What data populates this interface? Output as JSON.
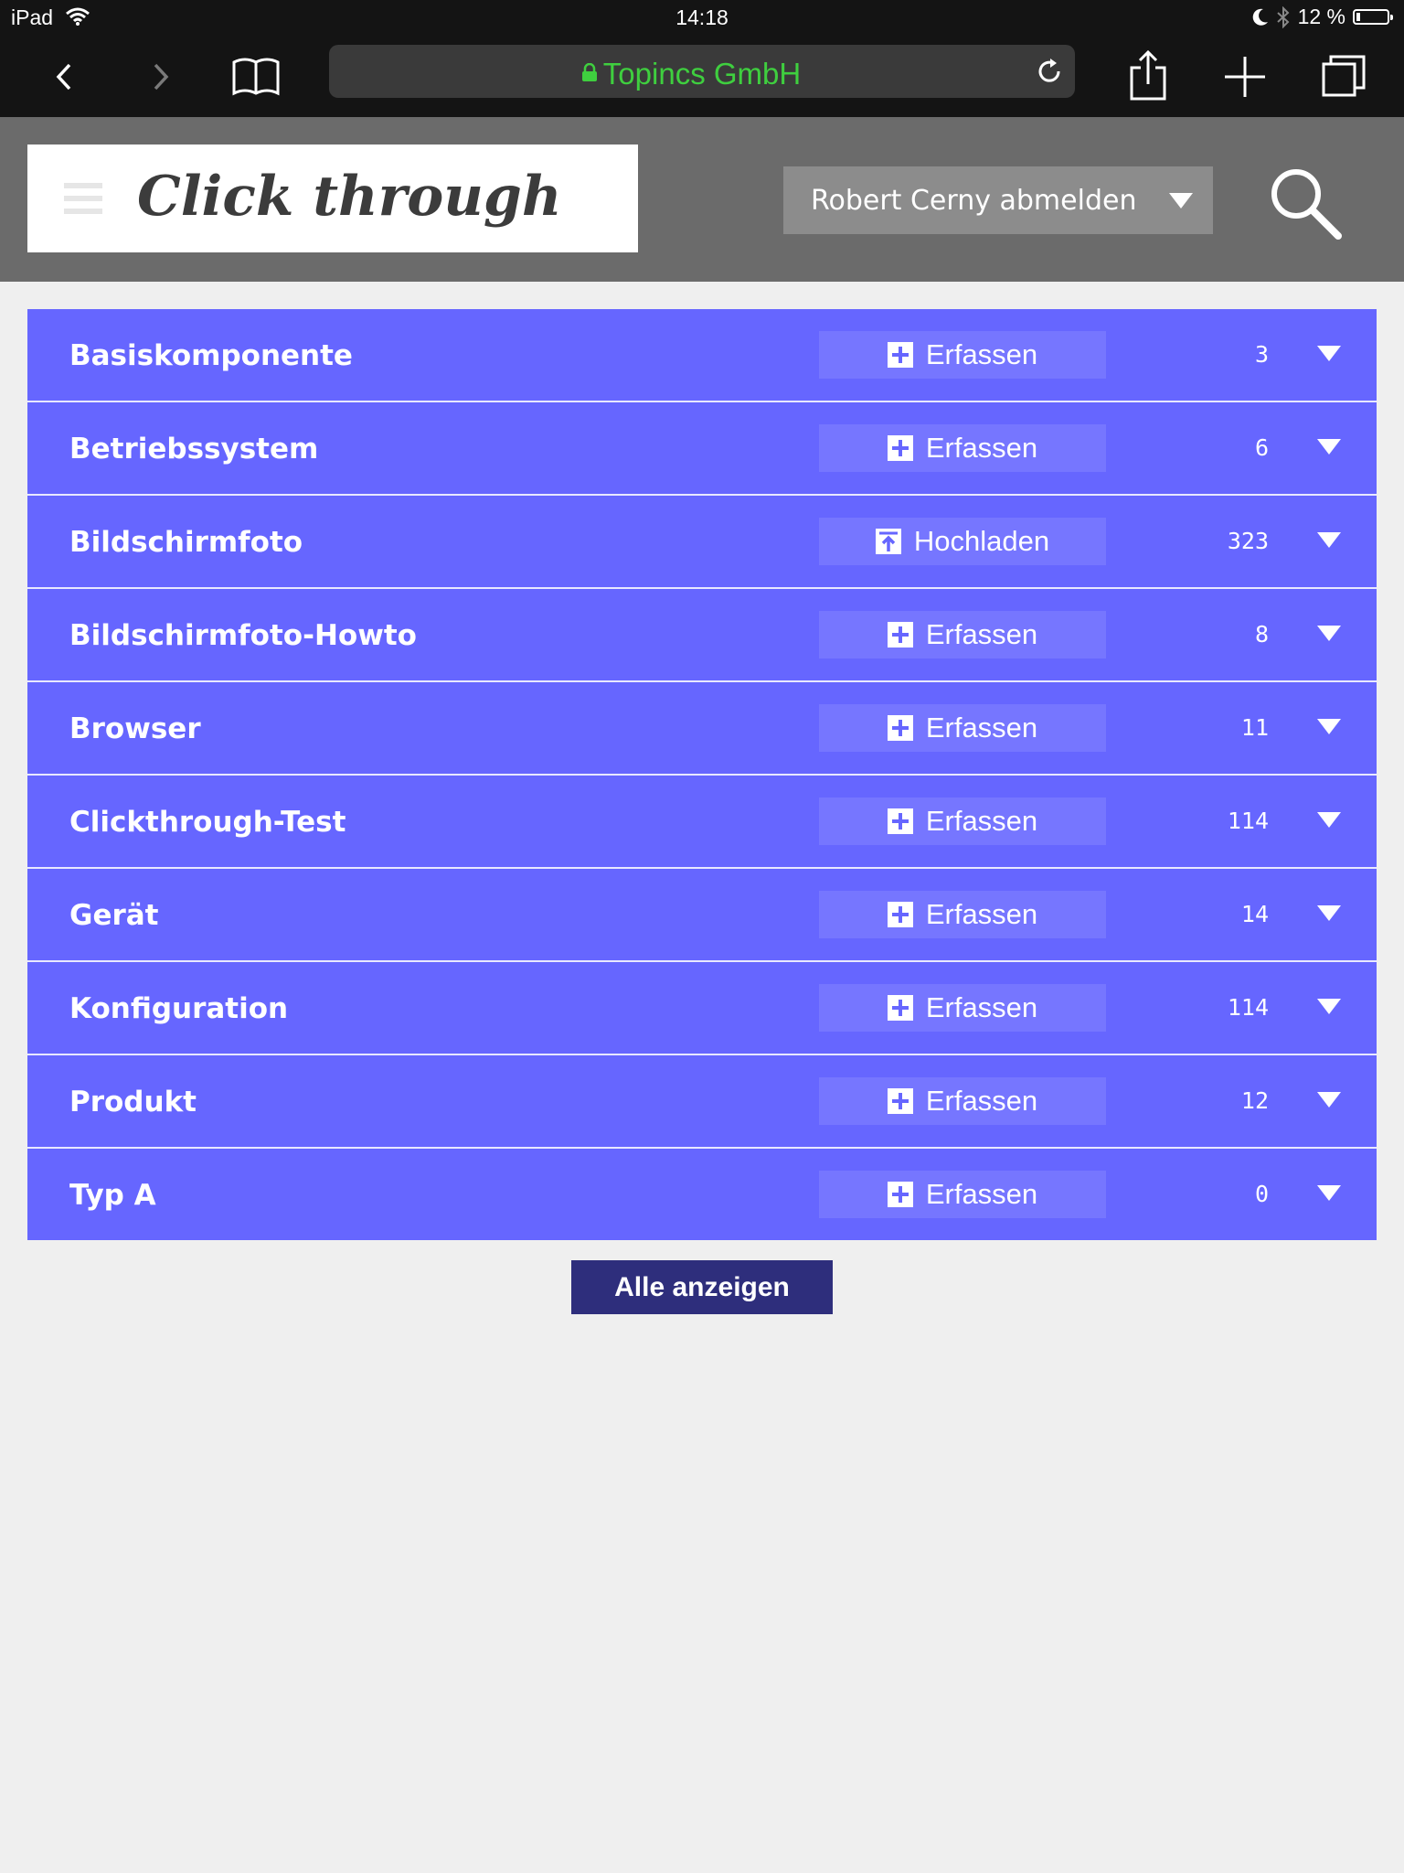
{
  "status_bar": {
    "device": "iPad",
    "time": "14:18",
    "battery": "12 %",
    "battery_level": 0.12,
    "icons": [
      "wifi-icon",
      "moon-icon",
      "bluetooth-icon",
      "battery-icon"
    ]
  },
  "browser": {
    "url_host": "Topincs GmbH",
    "url_color": "#3fcf3f",
    "icons": [
      "back-icon",
      "forward-icon",
      "bookmarks-icon",
      "lock-icon",
      "reload-icon",
      "share-icon",
      "new-tab-icon",
      "tabs-icon"
    ]
  },
  "header": {
    "logo": "Click through",
    "user_menu_label": "Robert Cerny abmelden",
    "icons": [
      "hamburger-icon",
      "search-icon"
    ]
  },
  "accent_colors": {
    "row": "#6666ff",
    "action": "#7676ff",
    "button": "#2e2e7c"
  },
  "rows": [
    {
      "name": "Basiskomponente",
      "action": "Erfassen",
      "icon": "plus-icon",
      "count": "3"
    },
    {
      "name": "Betriebssystem",
      "action": "Erfassen",
      "icon": "plus-icon",
      "count": "6"
    },
    {
      "name": "Bildschirmfoto",
      "action": "Hochladen",
      "icon": "upload-icon",
      "count": "323"
    },
    {
      "name": "Bildschirmfoto-Howto",
      "action": "Erfassen",
      "icon": "plus-icon",
      "count": "8"
    },
    {
      "name": "Browser",
      "action": "Erfassen",
      "icon": "plus-icon",
      "count": "11"
    },
    {
      "name": "Clickthrough-Test",
      "action": "Erfassen",
      "icon": "plus-icon",
      "count": "114"
    },
    {
      "name": "Gerät",
      "action": "Erfassen",
      "icon": "plus-icon",
      "count": "14"
    },
    {
      "name": "Konfiguration",
      "action": "Erfassen",
      "icon": "plus-icon",
      "count": "114"
    },
    {
      "name": "Produkt",
      "action": "Erfassen",
      "icon": "plus-icon",
      "count": "12"
    },
    {
      "name": "Typ A",
      "action": "Erfassen",
      "icon": "plus-icon",
      "count": "0"
    }
  ],
  "show_all_label": "Alle anzeigen"
}
